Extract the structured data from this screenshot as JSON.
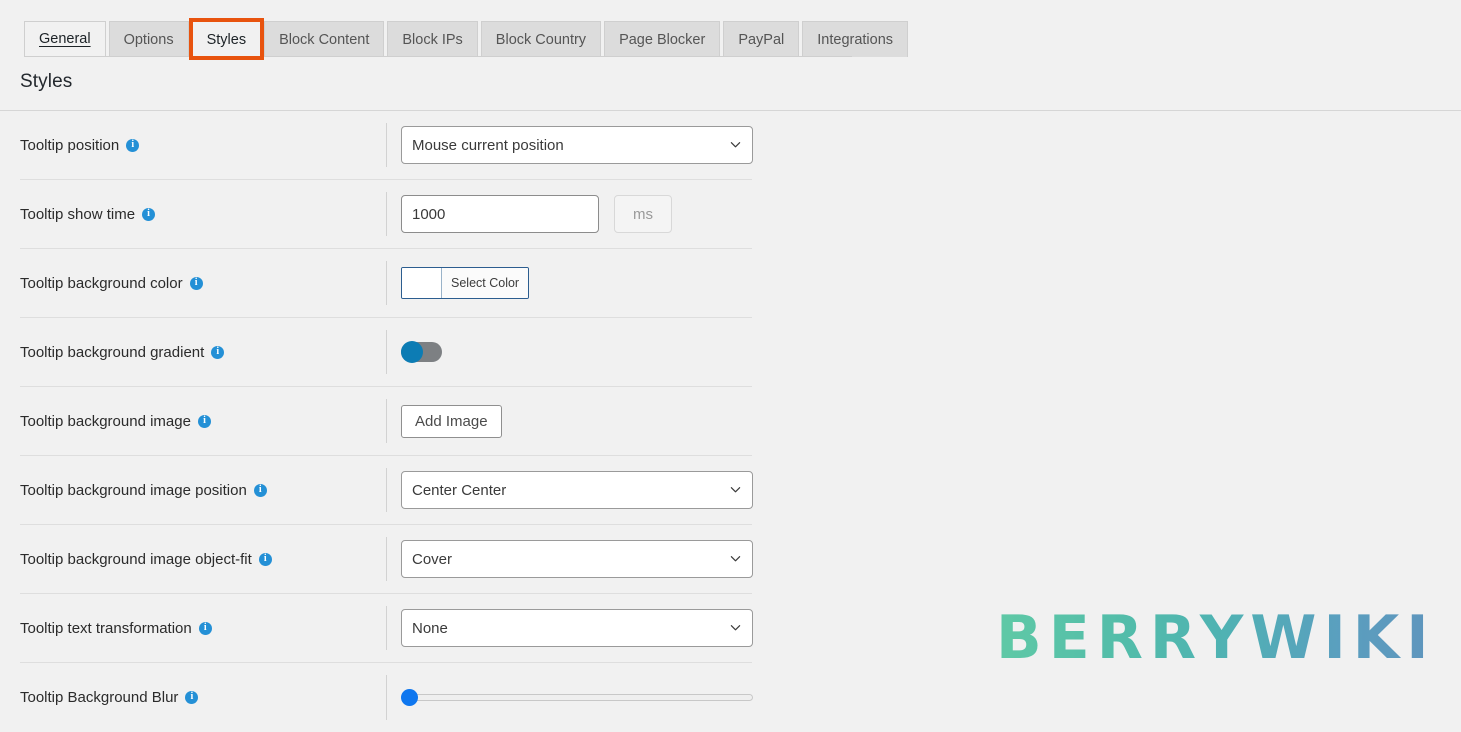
{
  "tabs": [
    {
      "label": "General",
      "state": "active"
    },
    {
      "label": "Options",
      "state": "inactive"
    },
    {
      "label": "Styles",
      "state": "highlighted"
    },
    {
      "label": "Block Content",
      "state": "inactive"
    },
    {
      "label": "Block IPs",
      "state": "inactive"
    },
    {
      "label": "Block Country",
      "state": "inactive"
    },
    {
      "label": "Page Blocker",
      "state": "inactive"
    },
    {
      "label": "PayPal",
      "state": "inactive"
    },
    {
      "label": "Integrations",
      "state": "inactive"
    }
  ],
  "page": {
    "title": "Styles"
  },
  "colors": {
    "highlight_outline": "#e8530e",
    "info_icon": "#2490d6",
    "toggle_knob": "#0c7cb4",
    "toggle_track": "#7d8083",
    "slider_thumb": "#0f77ef",
    "color_picker_border": "#2c5d8f",
    "page_background": "#f1f1f1",
    "tab_inactive": "#dcdcdc"
  },
  "rows": [
    {
      "label": "Tooltip position",
      "control": "select",
      "value": "Mouse current position"
    },
    {
      "label": "Tooltip show time",
      "control": "number",
      "value": "1000",
      "suffix": "ms"
    },
    {
      "label": "Tooltip background color",
      "control": "color",
      "value": "#ffffff",
      "button_label": "Select Color"
    },
    {
      "label": "Tooltip background gradient",
      "control": "toggle",
      "value": "off"
    },
    {
      "label": "Tooltip background image",
      "control": "button",
      "button_label": "Add Image"
    },
    {
      "label": "Tooltip background image position",
      "control": "select",
      "value": "Center Center"
    },
    {
      "label": "Tooltip background image object-fit",
      "control": "select",
      "value": "Cover"
    },
    {
      "label": "Tooltip text transformation",
      "control": "select",
      "value": "None"
    },
    {
      "label": "Tooltip Background Blur",
      "control": "slider",
      "value": "0"
    }
  ],
  "watermark": {
    "text": "BERRYWIKI"
  }
}
